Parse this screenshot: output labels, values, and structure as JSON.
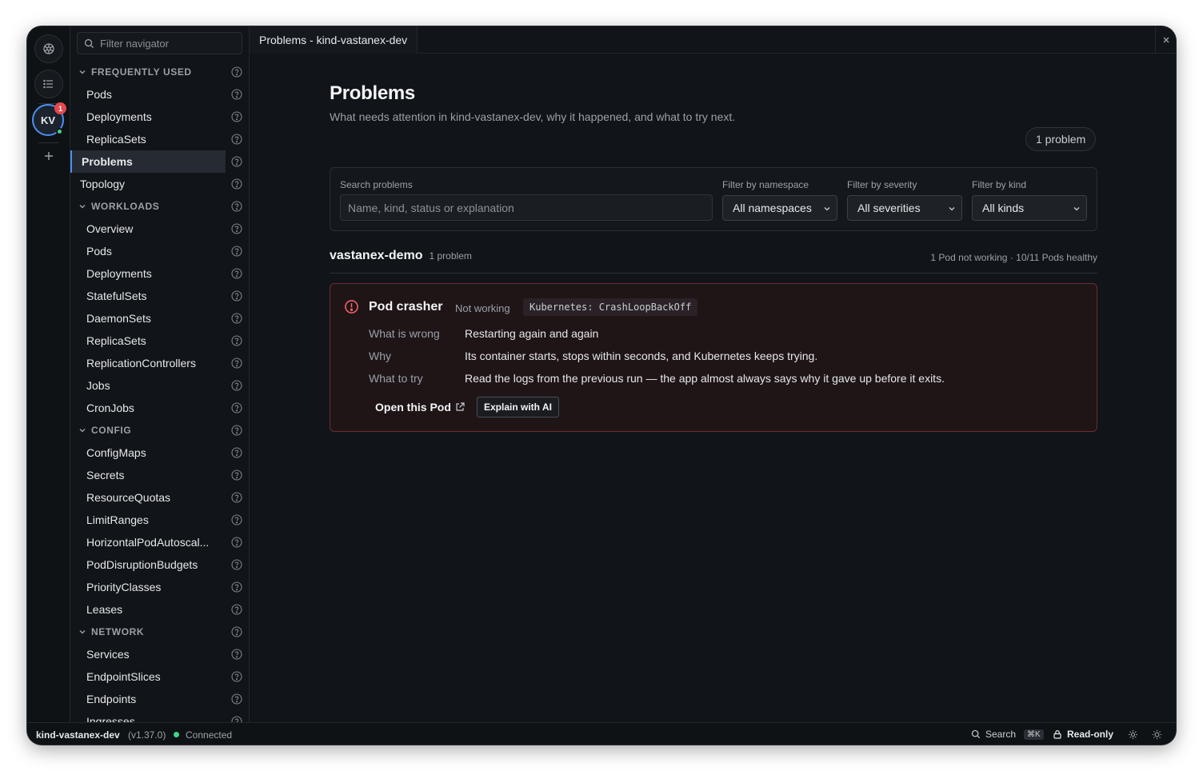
{
  "sidebar": {
    "filter_placeholder": "Filter navigator",
    "rows": [
      {
        "kind": "section",
        "label": "FREQUENTLY USED"
      },
      {
        "kind": "item",
        "label": "Pods"
      },
      {
        "kind": "item",
        "label": "Deployments"
      },
      {
        "kind": "item",
        "label": "ReplicaSets"
      },
      {
        "kind": "active",
        "label": "Problems"
      },
      {
        "kind": "top",
        "label": "Topology"
      },
      {
        "kind": "section",
        "label": "WORKLOADS"
      },
      {
        "kind": "item",
        "label": "Overview"
      },
      {
        "kind": "item",
        "label": "Pods"
      },
      {
        "kind": "item",
        "label": "Deployments"
      },
      {
        "kind": "item",
        "label": "StatefulSets"
      },
      {
        "kind": "item",
        "label": "DaemonSets"
      },
      {
        "kind": "item",
        "label": "ReplicaSets"
      },
      {
        "kind": "item",
        "label": "ReplicationControllers"
      },
      {
        "kind": "item",
        "label": "Jobs"
      },
      {
        "kind": "item",
        "label": "CronJobs"
      },
      {
        "kind": "section",
        "label": "CONFIG"
      },
      {
        "kind": "item",
        "label": "ConfigMaps"
      },
      {
        "kind": "item",
        "label": "Secrets"
      },
      {
        "kind": "item",
        "label": "ResourceQuotas"
      },
      {
        "kind": "item",
        "label": "LimitRanges"
      },
      {
        "kind": "item",
        "label": "HorizontalPodAutoscal..."
      },
      {
        "kind": "item",
        "label": "PodDisruptionBudgets"
      },
      {
        "kind": "item",
        "label": "PriorityClasses"
      },
      {
        "kind": "item",
        "label": "Leases"
      },
      {
        "kind": "section",
        "label": "NETWORK"
      },
      {
        "kind": "item",
        "label": "Services"
      },
      {
        "kind": "item",
        "label": "EndpointSlices"
      },
      {
        "kind": "item",
        "label": "Endpoints"
      },
      {
        "kind": "item",
        "label": "Ingresses"
      }
    ]
  },
  "rail": {
    "avatar_initials": "KV",
    "badge_count": "1"
  },
  "tab": {
    "title": "Problems - kind-vastanex-dev"
  },
  "main": {
    "title": "Problems",
    "subtitle": "What needs attention in kind-vastanex-dev, why it happened, and what to try next.",
    "count_pill": "1 problem",
    "filters": {
      "search_label": "Search problems",
      "search_placeholder": "Name, kind, status or explanation",
      "namespace_label": "Filter by namespace",
      "namespace_value": "All namespaces",
      "severity_label": "Filter by severity",
      "severity_value": "All severities",
      "kind_label": "Filter by kind",
      "kind_value": "All kinds"
    },
    "group": {
      "name": "vastanex-demo",
      "count": "1 problem",
      "health": "1 Pod not working · 10/11 Pods healthy"
    },
    "problem": {
      "name": "Pod crasher",
      "status": "Not working",
      "code": "Kubernetes: CrashLoopBackOff",
      "what_label": "What is wrong",
      "what_value": "Restarting again and again",
      "why_label": "Why",
      "why_value": "Its container starts, stops within seconds, and Kubernetes keeps trying.",
      "try_label": "What to try",
      "try_value": "Read the logs from the previous run — the app almost always says why it gave up before it exits.",
      "open_label": "Open this Pod",
      "ai_label": "Explain with AI"
    }
  },
  "statusbar": {
    "context": "kind-vastanex-dev",
    "version": "(v1.37.0)",
    "connection": "Connected",
    "search_label": "Search",
    "search_shortcut": "⌘K",
    "mode": "Read-only"
  },
  "colors": {
    "accent": "#4d8ff0",
    "error": "#ff6369",
    "success": "#3dd68c",
    "background": "#111418"
  }
}
